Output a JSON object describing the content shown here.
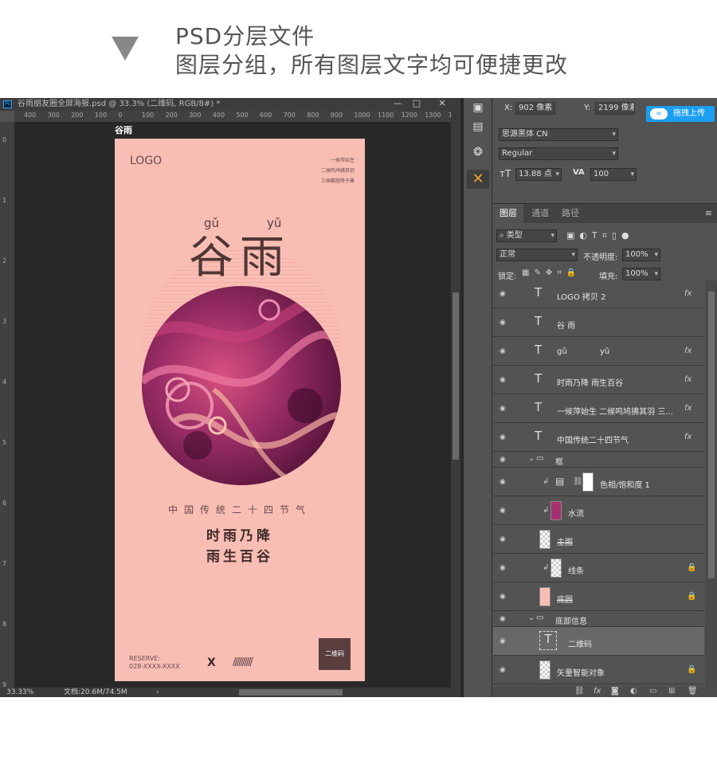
{
  "header": {
    "line1": "PSD分层文件",
    "line2": "图层分组，所有图层文字均可便捷更改"
  },
  "document": {
    "tab_title": "谷雨朋友圈全屏海报.psd @ 33.3% (二维码, RGB/8#) *",
    "ps_icon": "Ps",
    "window_buttons": [
      "—",
      "□",
      "✕"
    ],
    "artboard_label": "谷雨",
    "ruler_top_ticks": [
      "400",
      "300",
      "200",
      "100",
      "0",
      "100",
      "200",
      "300",
      "400",
      "500",
      "600",
      "700",
      "800",
      "900",
      "1000",
      "1100",
      "1200",
      "1300",
      "140"
    ],
    "ruler_left_ticks": [
      "0",
      "1",
      "2",
      "3",
      "4",
      "5",
      "6",
      "7",
      "8",
      "9"
    ],
    "zoom": "33.33%",
    "doc_size": "文档:20.6M/74.5M"
  },
  "poster": {
    "logo": "LOGO",
    "poem_lines": [
      "一候萍始生",
      "二候鸣鸠拂其羽",
      "三候戴胜降于桑"
    ],
    "pinyin": [
      "gǔ",
      "yǔ"
    ],
    "title": "谷雨",
    "subtitle": "中国传统二十四节气",
    "main_lines": [
      "时雨乃降",
      "雨生百谷"
    ],
    "reserve_label": "RESERVE:",
    "phone": "028-XXXX-XXXX",
    "x_mark": "X",
    "slashes": "//////////",
    "qr_label": "二维码"
  },
  "character_panel": {
    "x_label": "X:",
    "x_value": "902 像素",
    "y_label": "Y:",
    "y_value": "2199 像素",
    "upload_label": "拖拽上传",
    "font_family": "思源黑体 CN",
    "font_style": "Regular",
    "font_size": "13.88 点",
    "tracking": "100"
  },
  "layers_panel": {
    "tabs": [
      "图层",
      "通道",
      "路径"
    ],
    "filter_label": "类型",
    "blend_mode": "正常",
    "opacity_label": "不透明度:",
    "opacity_value": "100%",
    "lock_label": "锁定:",
    "fill_label": "填充:",
    "fill_value": "100%",
    "layers": [
      {
        "name": "LOGO 拷贝 2",
        "kind": "text",
        "fx": "fx"
      },
      {
        "name": "谷 雨",
        "kind": "text",
        "fx": ""
      },
      {
        "name": "gǔ             yǔ",
        "kind": "text",
        "fx": "fx"
      },
      {
        "name": "时雨乃降 雨生百谷",
        "kind": "text",
        "fx": "fx"
      },
      {
        "name": "一候萍始生 二候鸣鸠拂其羽 三...",
        "kind": "text",
        "fx": "fx"
      },
      {
        "name": "中国传统二十四节气",
        "kind": "text",
        "fx": "fx"
      },
      {
        "name": "框",
        "kind": "group"
      },
      {
        "name": "色相/饱和度 1",
        "kind": "adjust"
      },
      {
        "name": "水流",
        "kind": "image"
      },
      {
        "name": "主图",
        "kind": "image"
      },
      {
        "name": "线条",
        "kind": "image",
        "locked": true
      },
      {
        "name": "底圆",
        "kind": "image",
        "locked": true
      },
      {
        "name": "底部信息",
        "kind": "group"
      },
      {
        "name": "二维码",
        "kind": "text",
        "selected": true
      },
      {
        "name": "矢量智能对象",
        "kind": "image",
        "locked": true
      }
    ],
    "fx_symbol": "fx",
    "lock_symbol": "🔒"
  },
  "colors": {
    "poster_bg": "#f8beb4",
    "ps_panel": "#535353",
    "ps_canvas": "#282828",
    "accent_upload": "#1a9ff2"
  }
}
